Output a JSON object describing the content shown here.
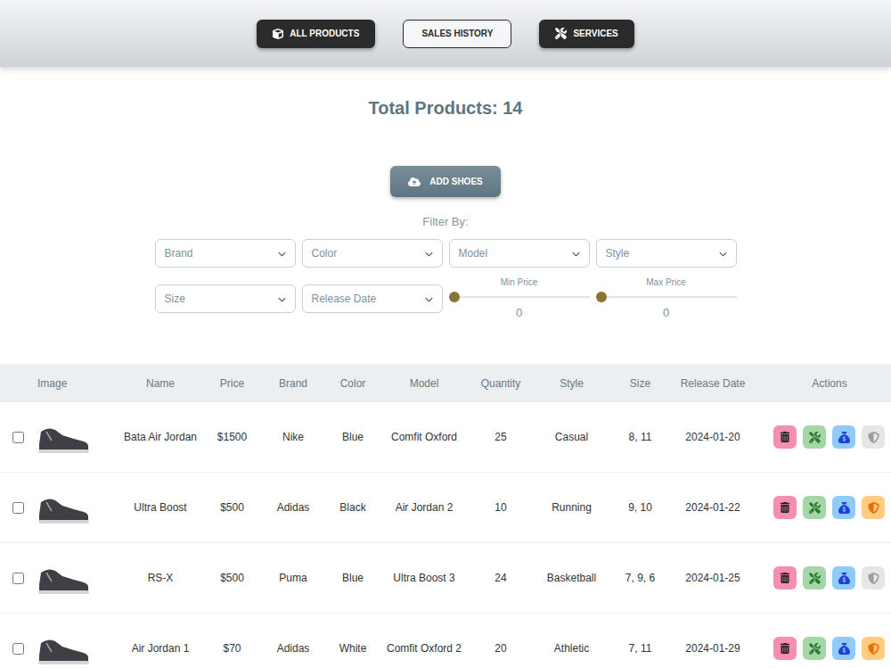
{
  "nav": [
    {
      "label": "ALL PRODUCTS",
      "kind": "dark",
      "icon": "cube"
    },
    {
      "label": "SALES HISTORY",
      "kind": "outline",
      "icon": "none"
    },
    {
      "label": "SERVICES",
      "kind": "dark",
      "icon": "tools"
    }
  ],
  "title": "Total Products: 14",
  "add_button": "ADD SHOES",
  "filter_label": "Filter By:",
  "filters": [
    {
      "placeholder": "Brand"
    },
    {
      "placeholder": "Color"
    },
    {
      "placeholder": "Model"
    },
    {
      "placeholder": "Style"
    },
    {
      "placeholder": "Size"
    },
    {
      "placeholder": "Release Date"
    }
  ],
  "sliders": [
    {
      "label": "Min Price",
      "value": "0",
      "level": 0
    },
    {
      "label": "Max Price",
      "value": "0",
      "level": 0
    }
  ],
  "table": {
    "columns": [
      "Image",
      "Name",
      "Price",
      "Brand",
      "Color",
      "Model",
      "Quantity",
      "Style",
      "Size",
      "Release Date",
      "Actions"
    ],
    "rows": [
      {
        "checked": false,
        "name": "Bata Air Jordan",
        "price": "$1500",
        "brand": "Nike",
        "color": "Blue",
        "model": "Comfit Oxford",
        "quantity": "25",
        "style": "Casual",
        "size": "8, 11",
        "release_date": "2024-01-20",
        "warranty": false
      },
      {
        "checked": false,
        "name": "Ultra Boost",
        "price": "$500",
        "brand": "Adidas",
        "color": "Black",
        "model": "Air Jordan 2",
        "quantity": "10",
        "style": "Running",
        "size": "9, 10",
        "release_date": "2024-01-22",
        "warranty": true
      },
      {
        "checked": false,
        "name": "RS-X",
        "price": "$500",
        "brand": "Puma",
        "color": "Blue",
        "model": "Ultra Boost 3",
        "quantity": "24",
        "style": "Basketball",
        "size": "7, 9, 6",
        "release_date": "2024-01-25",
        "warranty": false
      },
      {
        "checked": false,
        "name": "Air Jordan 1",
        "price": "$70",
        "brand": "Adidas",
        "color": "White",
        "model": "Comfit Oxford 2",
        "quantity": "20",
        "style": "Athletic",
        "size": "7, 11",
        "release_date": "2024-01-29",
        "warranty": true
      }
    ]
  }
}
